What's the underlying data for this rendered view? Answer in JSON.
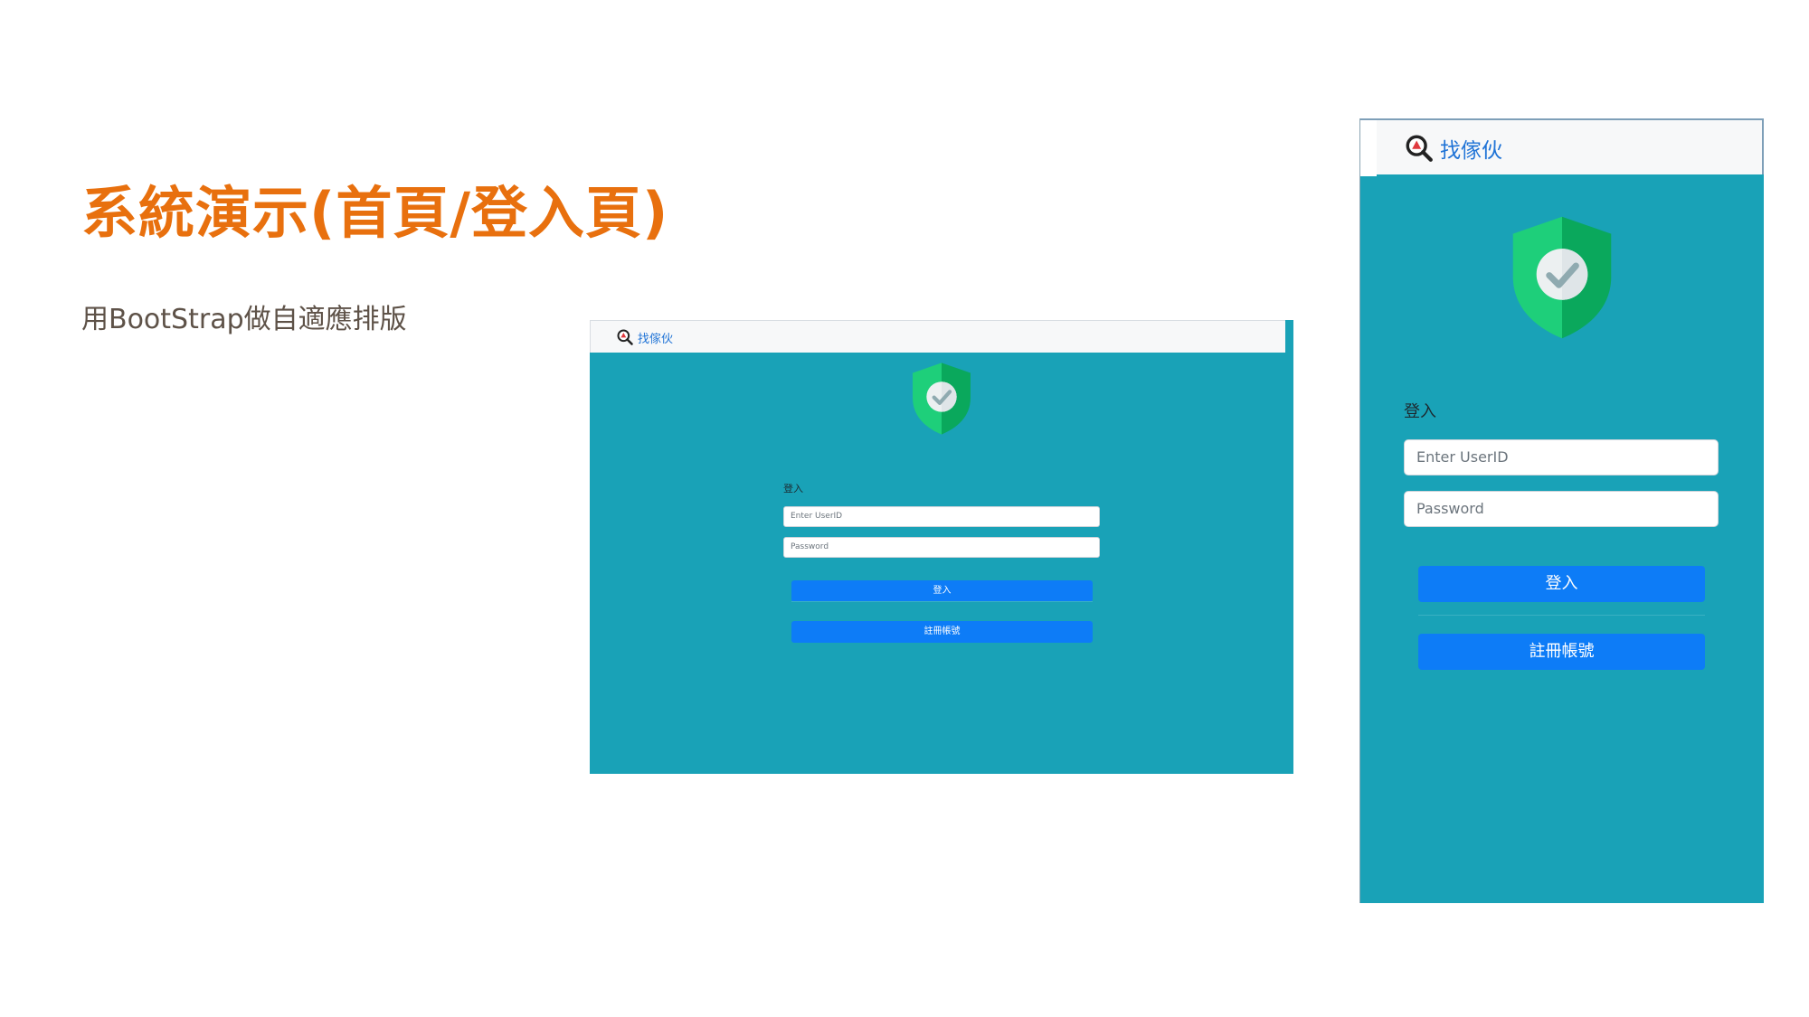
{
  "slide": {
    "title": "系統演示(首頁/登入頁)",
    "subtitle": "用BootStrap做自適應排版"
  },
  "app": {
    "brand_name": "找傢伙",
    "login_heading": "登入",
    "userid_placeholder": "Enter UserID",
    "password_placeholder": "Password",
    "login_button": "登入",
    "register_button": "註冊帳號"
  },
  "colors": {
    "title": "#e8700e",
    "page_bg": "#19a2b7",
    "button": "#0d7cf7",
    "brand_text": "#1f73d6",
    "shield_light": "#1ecf7a",
    "shield_dark": "#0aa85c"
  }
}
